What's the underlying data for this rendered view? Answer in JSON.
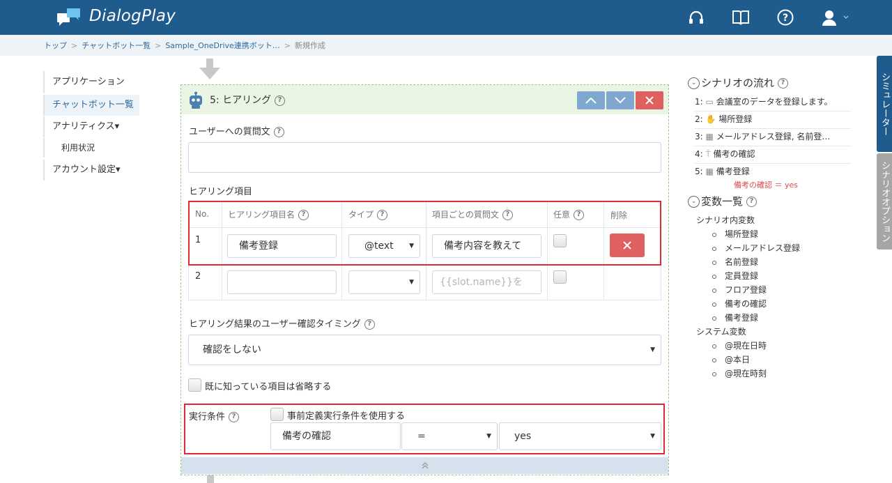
{
  "app": {
    "name": "DialogPlay"
  },
  "breadcrumb": [
    "トップ",
    "チャットボット一覧",
    "Sample_OneDrive連携ボット…",
    "新規作成"
  ],
  "sidebar": {
    "items": [
      {
        "label": "アプリケーション"
      },
      {
        "label": "チャットボット一覧"
      },
      {
        "label": "アナリティクス▾"
      },
      {
        "label": "利用状況"
      },
      {
        "label": "アカウント設定▾"
      }
    ]
  },
  "card": {
    "title": "5: ヒアリング",
    "question_label": "ユーザーへの質問文",
    "question_value": "",
    "items_label": "ヒアリング項目",
    "table": {
      "headers": [
        "No.",
        "ヒアリング項目名",
        "タイプ",
        "項目ごとの質問文",
        "任意",
        "削除"
      ],
      "rows": [
        {
          "no": "1",
          "name": "備考登録",
          "type": "@text",
          "question": "備考内容を教えて",
          "question_placeholder": ""
        },
        {
          "no": "2",
          "name": "",
          "type": "",
          "question": "",
          "question_placeholder": "{{slot.name}}を"
        }
      ]
    },
    "timing_label": "ヒアリング結果のユーザー確認タイミング",
    "timing_value": "確認をしない",
    "skip_label": "既に知っている項目は省略する",
    "condition_label": "実行条件",
    "predefined_label": "事前定義実行条件を使用する",
    "condition": {
      "variable": "備考の確認",
      "operator": "=",
      "value": "yes"
    }
  },
  "scenario_flow": {
    "title": "シナリオの流れ",
    "items": [
      {
        "no": "1:",
        "label": "会議室のデータを登録します。",
        "icon": "speech-bubble-icon"
      },
      {
        "no": "2:",
        "label": "場所登録",
        "icon": "hand-icon"
      },
      {
        "no": "3:",
        "label": "メールアドレス登録, 名前登…",
        "icon": "form-icon"
      },
      {
        "no": "4:",
        "label": "備考の確認",
        "icon": "signpost-icon"
      },
      {
        "no": "5:",
        "label": "備考登録",
        "icon": "form-icon"
      }
    ],
    "condition_note": "備考の確認 ＝ yes"
  },
  "variables": {
    "title": "変数一覧",
    "scenario_group": "シナリオ内変数",
    "scenario_vars": [
      "場所登録",
      "メールアドレス登録",
      "名前登録",
      "定員登録",
      "フロア登録",
      "備考の確認",
      "備考登録"
    ],
    "system_group": "システム変数",
    "system_vars": [
      "@現在日時",
      "@本日",
      "@現在時刻"
    ]
  },
  "tabs": {
    "simulator": "シミュレーター",
    "scenario_option": "シナリオオプション"
  },
  "colors": {
    "header": "#1f5b8c",
    "card_header": "#eaf5e3",
    "move_button": "#7fa7cf",
    "delete_button": "#e06060",
    "highlight": "#e02a32"
  }
}
